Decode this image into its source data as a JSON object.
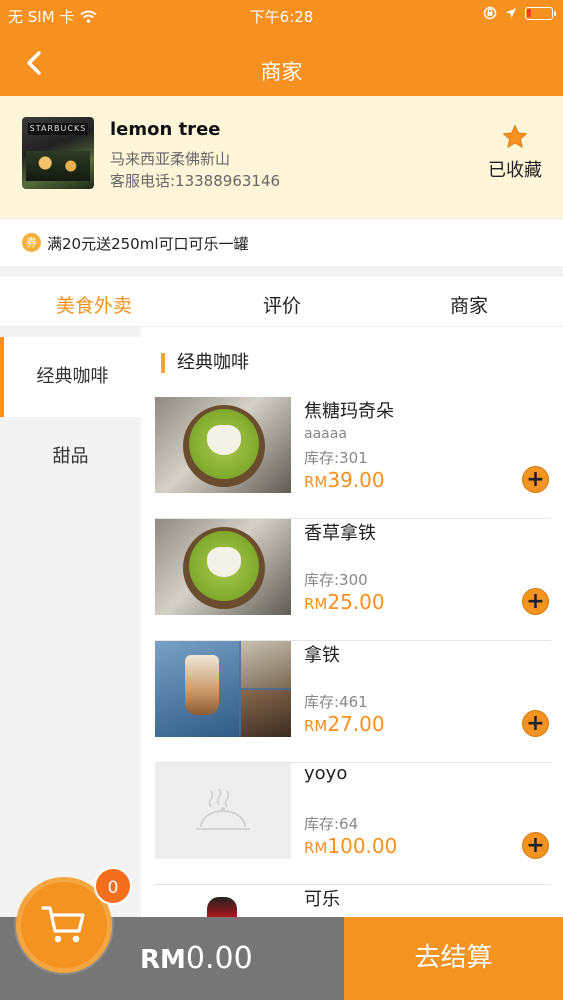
{
  "statusbar": {
    "carrier": "无 SIM 卡",
    "time": "下午6:28"
  },
  "navbar": {
    "title": "商家"
  },
  "merchant": {
    "logo_sign": "STARBUCKS",
    "name": "lemon tree",
    "address": "马来西亚柔佛新山",
    "phone": "客服电话:13388963146",
    "favorite_label": "已收藏"
  },
  "promo": {
    "coupon_badge": "券",
    "text": "满20元送250ml可口可乐一罐"
  },
  "tabs": [
    {
      "label": "美食外卖",
      "active": true
    },
    {
      "label": "评价",
      "active": false
    },
    {
      "label": "商家",
      "active": false
    }
  ],
  "categories": [
    {
      "label": "经典咖啡",
      "active": true
    },
    {
      "label": "甜品",
      "active": false
    }
  ],
  "section_title": "经典咖啡",
  "items": [
    {
      "name": "焦糖玛奇朵",
      "desc": "aaaaa",
      "stock": "库存:301",
      "currency": "RM",
      "price": "39.00",
      "add": "+"
    },
    {
      "name": "香草拿铁",
      "desc": "",
      "stock": "库存:300",
      "currency": "RM",
      "price": "25.00",
      "add": "+"
    },
    {
      "name": "拿铁",
      "desc": "",
      "stock": "库存:461",
      "currency": "RM",
      "price": "27.00",
      "add": "+"
    },
    {
      "name": "yoyo",
      "desc": "",
      "stock": "库存:64",
      "currency": "RM",
      "price": "100.00",
      "add": "+"
    },
    {
      "name": "可乐",
      "desc": "",
      "stock": "",
      "currency": "",
      "price": "",
      "add": ""
    }
  ],
  "cart": {
    "count": "0",
    "currency": "RM",
    "total": "0.00",
    "checkout_label": "去结算"
  },
  "colors": {
    "accent": "#f6901e",
    "header_bg": "#fff6d9",
    "cart_left": "#767676"
  }
}
